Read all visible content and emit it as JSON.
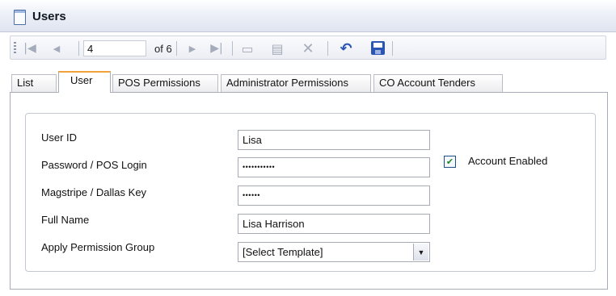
{
  "window": {
    "title": "Users"
  },
  "navigator": {
    "record_value": "4",
    "record_total": "of 6",
    "icons": {
      "first": "first-record-icon",
      "prev": "previous-record-icon",
      "next": "next-record-icon",
      "last": "last-record-icon",
      "new": "new-record-icon",
      "edit": "edit-record-icon",
      "delete": "delete-record-icon",
      "undo": "undo-icon",
      "save": "save-icon"
    },
    "glyphs": {
      "first": "|◀",
      "prev": "◀",
      "next": "▶",
      "last": "▶|",
      "new": "▭",
      "edit": "▤",
      "delete": "✕",
      "undo": "↶"
    }
  },
  "tabs": [
    {
      "label": "List",
      "active": false
    },
    {
      "label": "User",
      "active": true
    },
    {
      "label": "POS Permissions",
      "active": false
    },
    {
      "label": "Administrator Permissions",
      "active": false
    },
    {
      "label": "CO Account Tenders",
      "active": false
    }
  ],
  "form": {
    "user_id": {
      "label": "User ID",
      "value": "Lisa"
    },
    "password": {
      "label": "Password / POS Login",
      "value": "•••••••••••"
    },
    "magstripe": {
      "label": "Magstripe / Dallas Key",
      "value": "••••••"
    },
    "full_name": {
      "label": "Full Name",
      "value": "Lisa Harrison"
    },
    "permission_group": {
      "label": "Apply Permission Group",
      "value": "[Select Template]"
    },
    "account_enabled": {
      "label": "Account Enabled",
      "checked": true
    }
  },
  "colors": {
    "active_tab_accent": "#f0a33a",
    "save_icon": "#2a55b5",
    "undo_icon": "#2a55b5",
    "checkmark": "#1d8a1d"
  }
}
